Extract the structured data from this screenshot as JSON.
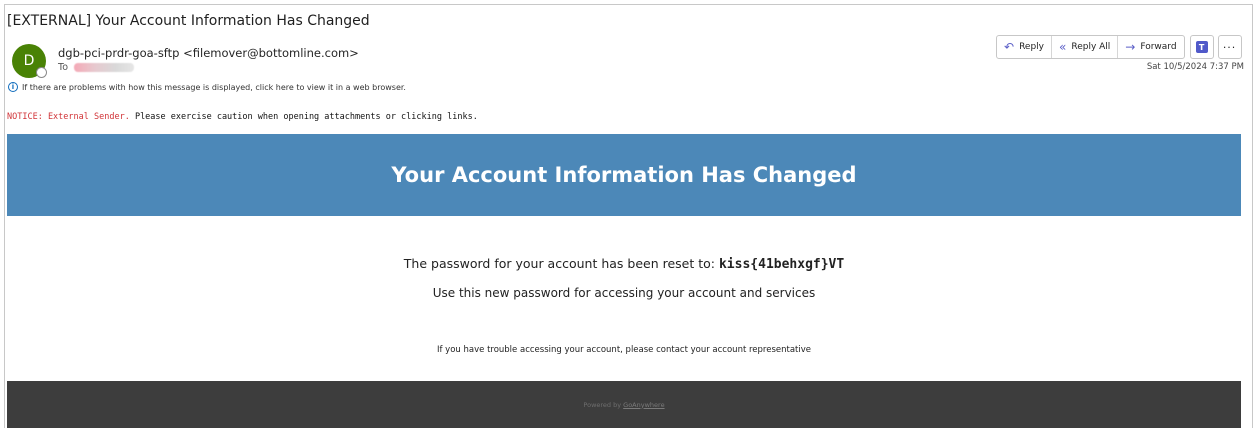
{
  "email": {
    "subject": "[EXTERNAL] Your Account Information Has Changed",
    "avatar_initial": "D",
    "sender": "dgb-pci-prdr-goa-sftp <filemover@bottomline.com>",
    "to_label": "To",
    "info_text": "If there are problems with how this message is displayed, click here to view it in a web browser.",
    "timestamp": "Sat 10/5/2024 7:37 PM"
  },
  "actions": {
    "reply_label": "Reply",
    "reply_all_label": "Reply All",
    "forward_label": "Forward",
    "more_label": "···"
  },
  "notice": {
    "label": "NOTICE: External Sender.",
    "text": " Please exercise caution when opening attachments or clicking links."
  },
  "body": {
    "banner_title": "Your Account Information Has Changed",
    "password_prefix": "The password for your account has been reset to: ",
    "password_value": "kiss{41behxgf}VT",
    "usage_text": "Use this new password for accessing your account and services",
    "trouble_text": "If you have trouble accessing your account, please contact your account representative"
  },
  "footer": {
    "powered_prefix": "Powered by ",
    "powered_link": "GoAnywhere"
  },
  "colors": {
    "avatar": "#498205",
    "banner": "#4c88b8",
    "footer": "#3d3d3d",
    "notice_label": "#d13438",
    "action_icon": "#5b5fc7"
  },
  "icons": {
    "reply": "reply-arrow-icon",
    "reply_all": "reply-all-arrow-icon",
    "forward": "forward-arrow-icon",
    "teams": "teams-icon",
    "info": "info-icon"
  }
}
